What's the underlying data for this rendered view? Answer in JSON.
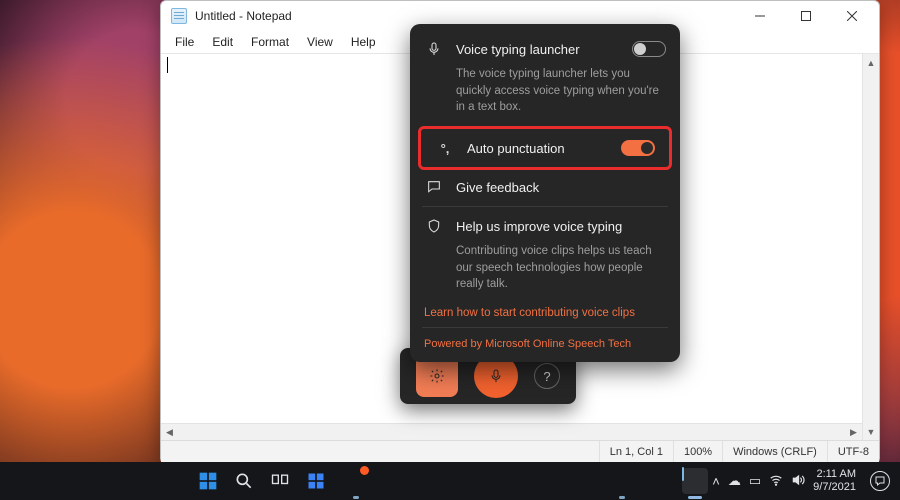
{
  "window": {
    "title": "Untitled - Notepad",
    "menus": [
      "File",
      "Edit",
      "Format",
      "View",
      "Help"
    ]
  },
  "status": {
    "position": "Ln 1, Col 1",
    "zoom": "100%",
    "eol": "Windows (CRLF)",
    "encoding": "UTF-8"
  },
  "voice_panel": {
    "launcher_label": "Voice typing launcher",
    "launcher_desc": "The voice typing launcher lets you quickly access voice typing when you're in a text box.",
    "launcher_on": false,
    "auto_punct_label": "Auto punctuation",
    "auto_punct_on": true,
    "feedback_label": "Give feedback",
    "improve_label": "Help us improve voice typing",
    "improve_desc": "Contributing voice clips helps us teach our speech technologies how people really talk.",
    "learn_link": "Learn how to start contributing voice clips",
    "footer": "Powered by Microsoft Online Speech Tech"
  },
  "tray": {
    "time": "2:11 AM",
    "date": "9/7/2021"
  }
}
